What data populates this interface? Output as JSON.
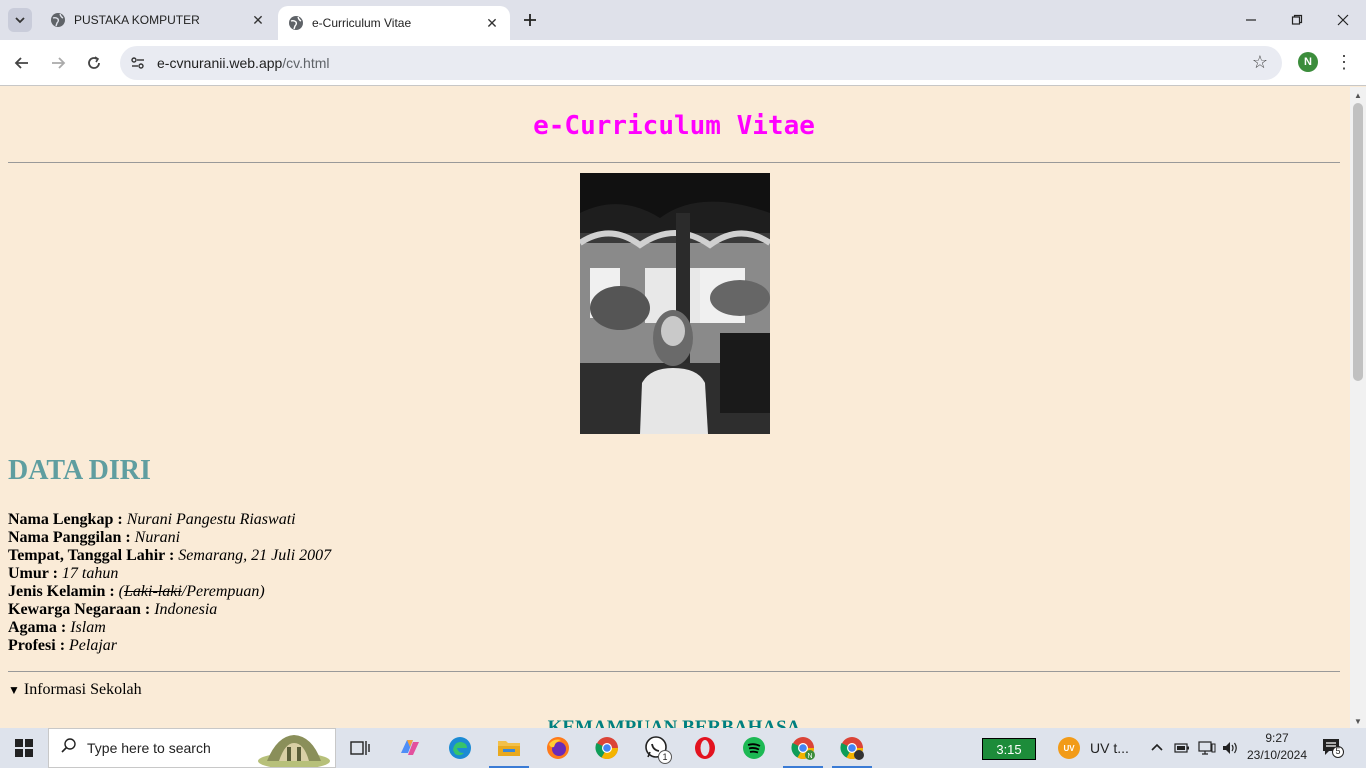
{
  "browser": {
    "tabs": [
      {
        "title": "PUSTAKA KOMPUTER",
        "active": false
      },
      {
        "title": "e-Curriculum Vitae",
        "active": true
      }
    ],
    "url_host": "e-cvnuranii.web.app",
    "url_path": "/cv.html",
    "profile_initial": "N"
  },
  "page": {
    "title": "e-Curriculum Vitae",
    "photo_alt": "profile-photo",
    "section_heading": "DATA DIRI",
    "fields": [
      {
        "label": "Nama Lengkap :",
        "value": "Nurani Pangestu Riaswati"
      },
      {
        "label": "Nama Panggilan :",
        "value": "Nurani"
      },
      {
        "label": "Tempat, Tanggal Lahir :",
        "value": "Semarang, 21 Juli 2007"
      },
      {
        "label": "Umur :",
        "value": "17 tahun"
      },
      {
        "label": "Jenis Kelamin :",
        "value_open": "(",
        "value_struck": "Laki-laki",
        "value_rest": "/Perempuan)"
      },
      {
        "label": "Kewarga Negaraan :",
        "value": "Indonesia"
      },
      {
        "label": "Agama :",
        "value": "Islam"
      },
      {
        "label": "Profesi :",
        "value": "Pelajar"
      }
    ],
    "details_summary": "Informasi Sekolah",
    "next_heading": "KEMAMPUAN BERBAHASA"
  },
  "taskbar": {
    "search_placeholder": "Type here to search",
    "whatsapp_badge": "1",
    "battery_time": "3:15",
    "uv_label": "UV t...",
    "uv_logo": "UV",
    "clock_time": "9:27",
    "clock_date": "23/10/2024",
    "notification_count": "5"
  },
  "colors": {
    "page_bg": "#faebd7",
    "title": "#ff00ff",
    "heading": "#5f9ea0",
    "next_heading": "#008080"
  }
}
